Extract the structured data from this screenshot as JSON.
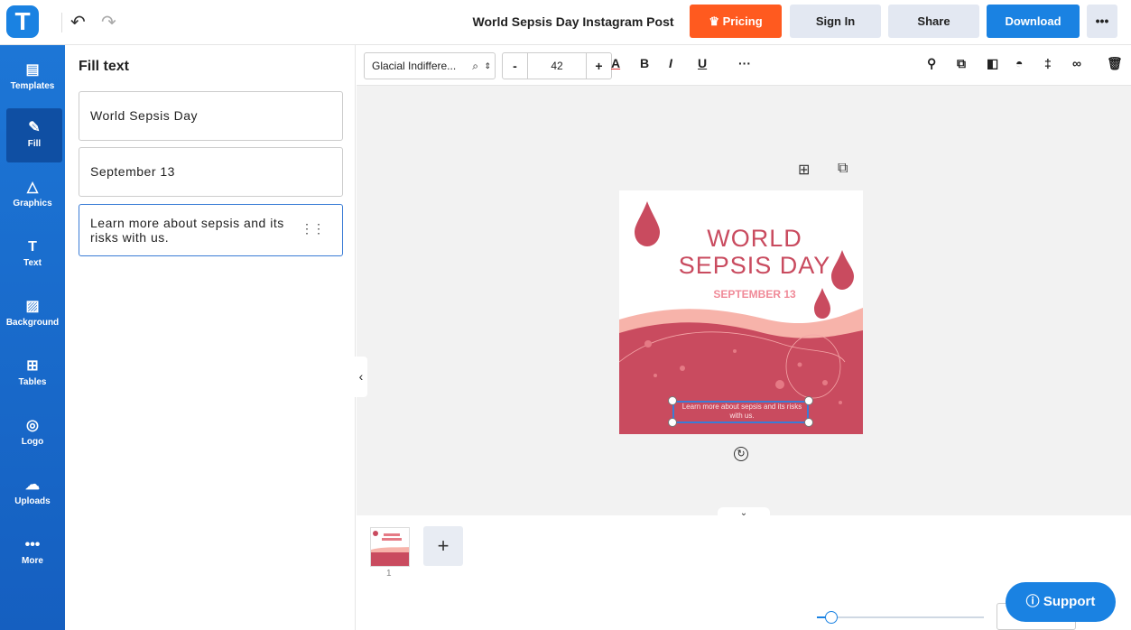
{
  "app": {
    "logo_letter": "T",
    "document_title": "World Sepsis Day Instagram Post"
  },
  "header": {
    "pricing_label": "Pricing",
    "signin_label": "Sign In",
    "share_label": "Share",
    "download_label": "Download",
    "more_label": "•••"
  },
  "sidebar": {
    "items": [
      {
        "label": "Templates",
        "icon": "templates-icon"
      },
      {
        "label": "Fill",
        "icon": "pencil-icon"
      },
      {
        "label": "Graphics",
        "icon": "shapes-icon"
      },
      {
        "label": "Text",
        "icon": "text-icon"
      },
      {
        "label": "Background",
        "icon": "background-icon"
      },
      {
        "label": "Tables",
        "icon": "table-icon"
      },
      {
        "label": "Logo",
        "icon": "logo-icon"
      },
      {
        "label": "Uploads",
        "icon": "upload-icon"
      },
      {
        "label": "More",
        "icon": "more-icon"
      }
    ]
  },
  "panel": {
    "title": "Fill text",
    "fields": [
      {
        "value": "World Sepsis Day"
      },
      {
        "value": "September 13"
      },
      {
        "value": "Learn more about sepsis and its risks with us."
      }
    ]
  },
  "toolbar": {
    "font_name": "Glacial Indiffere...",
    "font_size": "42",
    "minus": "-",
    "plus": "+"
  },
  "design": {
    "title_line1": "WORLD",
    "title_line2": "SEPSIS DAY",
    "date": "SEPTEMBER 13",
    "body": "Learn more about sepsis and its risks with us.",
    "colors": {
      "primary": "#c94b5f",
      "light": "#f7b3aa",
      "accent": "#f08a98"
    }
  },
  "pages": {
    "current_page": "1",
    "add_label": "+"
  },
  "support": {
    "label": "Support"
  },
  "accent_color": "#1a82e2",
  "pricing_color": "#ff5a1f"
}
